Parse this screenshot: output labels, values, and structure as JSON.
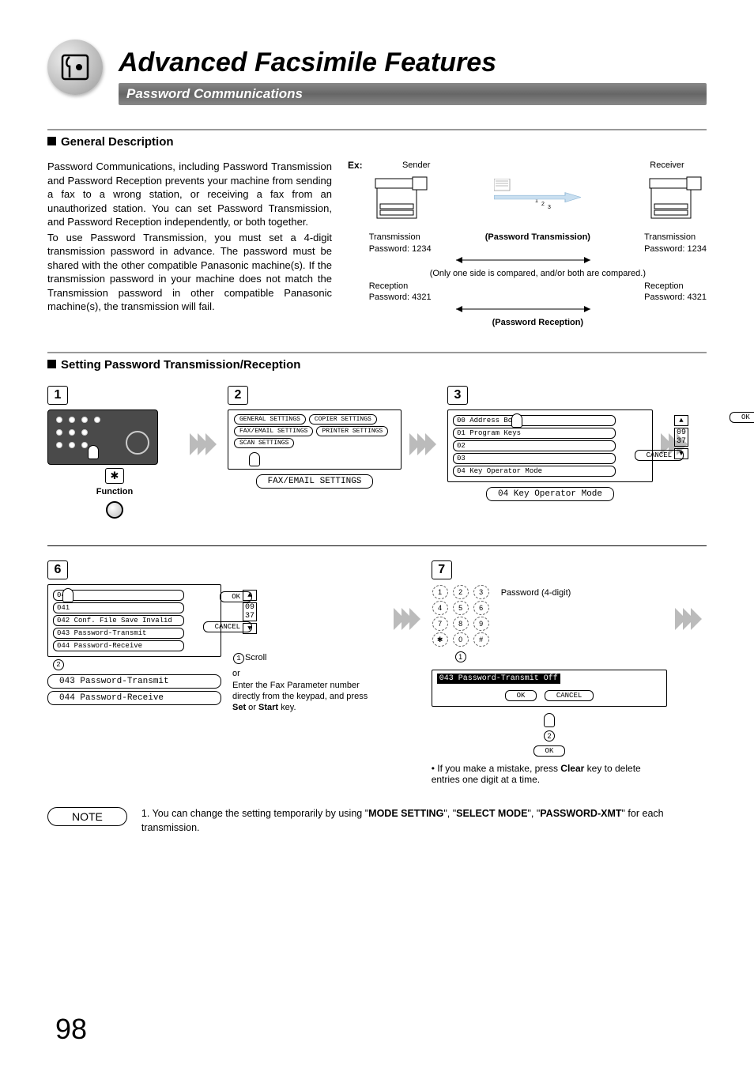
{
  "chapter_title": "Advanced Facsimile Features",
  "section_bar": "Password Communications",
  "sub1": "General Description",
  "para1": "Password Communications, including Password Transmission and Password Reception prevents your machine from sending a fax to a wrong station, or receiving a fax from an unauthorized station. You can set Password Transmission, and Password Reception independently, or both together.",
  "para2": "To use Password Transmission, you must set a 4-digit transmission password in advance. The password must be shared with the other compatible Panasonic machine(s). If the transmission password in your machine does not match the Transmission password in other compatible Panasonic machine(s), the transmission will fail.",
  "diagram": {
    "ex": "Ex:",
    "sender": "Sender",
    "receiver": "Receiver",
    "tx_label": "Transmission",
    "tx_pw_l": "Password: 1234",
    "rx_label_l": "Reception",
    "rx_pw_l": "Password: 4321",
    "pt_bold": "(Password Transmission)",
    "only": "(Only one side is compared, and/or both are compared.)",
    "tx_label_r": "Transmission",
    "tx_pw_r": "Password: 1234",
    "rx_label_r": "Reception",
    "rx_pw_r": "Password: 4321",
    "pr_bold": "(Password Reception)"
  },
  "sub2": "Setting Password Transmission/Reception",
  "steps": {
    "s1": "1",
    "s2": "2",
    "s3": "3",
    "s6": "6",
    "s7": "7",
    "func": "Function",
    "menu": {
      "general": "GENERAL SETTINGS",
      "copier": "COPIER SETTINGS",
      "faxemail": "FAX/EMAIL SETTINGS",
      "printer": "PRINTER SETTINGS",
      "scan": "SCAN SETTINGS"
    },
    "faxemail_btn": "FAX/EMAIL SETTINGS",
    "list3": {
      "a": "00 Address Book",
      "b": "01 Program Keys",
      "c": "02",
      "d": "03",
      "e": "04 Key Operator Mode",
      "ok": "OK",
      "cancel": "CANCEL"
    },
    "key_op_btn": "04  Key Operator Mode",
    "s6box": {
      "l040": "040",
      "l041": "041",
      "l042": "042  Conf. File Save        Invalid",
      "l043": "043  Password-Transmit",
      "l044": "044  Password-Receive",
      "ok": "OK",
      "cancel": "CANCEL"
    },
    "scroll": "Scroll",
    "s6btn1": "043  Password-Transmit",
    "s6btn2": "044  Password-Receive",
    "s6or": "or",
    "s6text": "Enter the Fax Parameter number directly from the keypad, and press ",
    "s6text_set": "Set",
    "s6text_or": " or ",
    "s6text_start": "Start",
    "s6text_end": " key.",
    "s7label": "Password (4-digit)",
    "s7_paramline": "043 Password-Transmit    Off",
    "s7_ok": "OK",
    "s7_cancel": "CANCEL",
    "s7_bullet_pre": "If you make a mistake, press ",
    "s7_clear": "Clear",
    "s7_bullet_post": " key to delete entries one digit at a time."
  },
  "note": {
    "label": "NOTE",
    "text_pre": "1. You can change the setting temporarily by using \"",
    "mode_setting": "MODE SETTING",
    "mid1": "\", \"",
    "select_mode": "SELECT MODE",
    "mid2": "\", \"",
    "pwd_xmt": "PASSWORD-XMT",
    "text_post": "\" for each transmission."
  },
  "page_number": "98"
}
